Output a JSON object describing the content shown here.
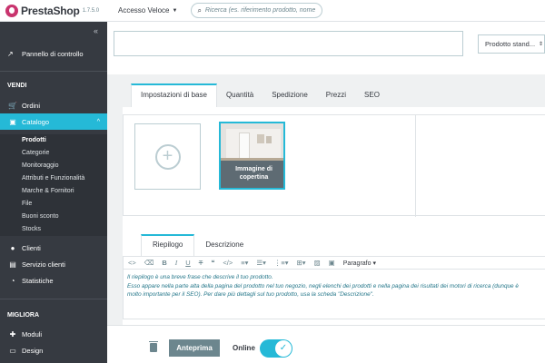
{
  "brand": {
    "name": "PrestaShop",
    "version": "1.7.5.0"
  },
  "header": {
    "quick_access": "Accesso Veloce",
    "search_placeholder": "Ricerca (es. riferimento prodotto, nome"
  },
  "sidebar": {
    "dashboard": "Pannello di controllo",
    "section_sell": "VENDI",
    "orders": "Ordini",
    "catalog": "Catalogo",
    "catalog_sub": [
      "Prodotti",
      "Categorie",
      "Monitoraggio",
      "Attributi e Funzionalità",
      "Marche & Fornitori",
      "File",
      "Buoni sconto",
      "Stocks"
    ],
    "customers": "Clienti",
    "customer_service": "Servizio clienti",
    "stats": "Statistiche",
    "section_improve": "MIGLIORA",
    "modules": "Moduli",
    "design": "Design"
  },
  "product": {
    "name_value": "",
    "type_selected": "Prodotto stand..."
  },
  "tabs": [
    "Impostazioni di base",
    "Quantità",
    "Spedizione",
    "Prezzi",
    "SEO"
  ],
  "images": {
    "cover_label": "Immagine di copertina"
  },
  "description": {
    "tabs": [
      "Riepilogo",
      "Descrizione"
    ],
    "paragraph_select": "Paragrafo",
    "lines": [
      "Il riepilogo è una breve frase che descrive il tuo prodotto.",
      "Esso appare nella parte alta della pagina del prodotto nel tuo negozio, negli elenchi dei prodotti e nella pagina dei risultati dei motori di ricerca (dunque è",
      "molto importante per il SEO). Per dare più dettagli sul tuo prodotto, usa la scheda \"Descrizione\"."
    ]
  },
  "footer": {
    "preview": "Anteprima",
    "online": "Online",
    "online_enabled": true
  },
  "colors": {
    "accent": "#25b9d7",
    "sidebar": "#363a41",
    "brand": "#c9346e"
  }
}
